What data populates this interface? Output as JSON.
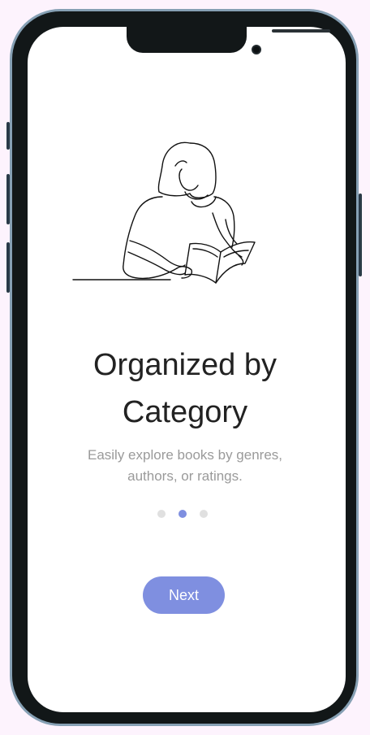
{
  "onboarding": {
    "title": "Organized by\nCategory",
    "subtitle": "Easily explore books by genres,\nauthors, or ratings.",
    "illustration_icon": "woman-reading-book-icon",
    "pagination": {
      "count": 3,
      "active_index": 1
    },
    "next_label": "Next"
  },
  "colors": {
    "accent": "#7f8fe0",
    "dot_inactive": "#e0e0e0",
    "title": "#222222",
    "subtitle": "#9a9a9a",
    "frame": "#121718",
    "background": "#fdf3fd"
  }
}
